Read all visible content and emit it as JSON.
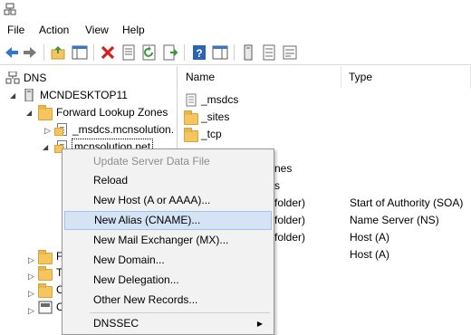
{
  "menubar": {
    "items": [
      "File",
      "Action",
      "View",
      "Help"
    ]
  },
  "toolbar": {
    "buttons": [
      "back-arrow-icon",
      "forward-arrow-icon",
      "up-folder-icon",
      "show-hide-tree-icon",
      "delete-icon",
      "properties-icon",
      "refresh-icon",
      "export-list-icon",
      "help-icon",
      "action-pane-icon",
      "server-icon",
      "list-icon",
      "record-icon"
    ]
  },
  "tree": {
    "root": "DNS",
    "server": "MCNDESKTOP11",
    "forward_zones": "Forward Lookup Zones",
    "zone1": "_msdcs.mcnsolution.",
    "zone2": "mcnsolution.net"
  },
  "list": {
    "columns": [
      "Name",
      "Type"
    ],
    "rows": [
      {
        "name": "_msdcs",
        "type": ""
      },
      {
        "name": "_sites",
        "type": ""
      },
      {
        "name": "_tcp",
        "type": ""
      }
    ],
    "partial_rows": [
      {
        "name_tail": "nes",
        "type": ""
      },
      {
        "name_tail": "s",
        "type": ""
      },
      {
        "name_tail": "folder)",
        "type": "Start of Authority (SOA)"
      },
      {
        "name_tail": "folder)",
        "type": "Name Server (NS)"
      },
      {
        "name_tail": "folder)",
        "type": "Host (A)"
      },
      {
        "name_tail": "",
        "type": "Host (A)"
      }
    ]
  },
  "context_menu": {
    "items": [
      {
        "label": "Update Server Data File",
        "disabled": true
      },
      {
        "label": "Reload",
        "disabled": false
      },
      {
        "label": "New Host (A or AAAA)...",
        "disabled": false
      },
      {
        "label": "New Alias (CNAME)...",
        "disabled": false,
        "highlighted": true
      },
      {
        "label": "New Mail Exchanger (MX)...",
        "disabled": false
      },
      {
        "label": "New Domain...",
        "disabled": false
      },
      {
        "label": "New Delegation...",
        "disabled": false
      },
      {
        "label": "Other New Records...",
        "disabled": false
      },
      {
        "label": "DNSSEC",
        "disabled": false,
        "submenu": true
      }
    ]
  },
  "left_tree_partial": [
    "F",
    "T",
    "C",
    "C"
  ],
  "colors": {
    "highlight": "#d5e4f4",
    "folder": "#f4c65d",
    "disabled_text": "#8d8d8d"
  }
}
